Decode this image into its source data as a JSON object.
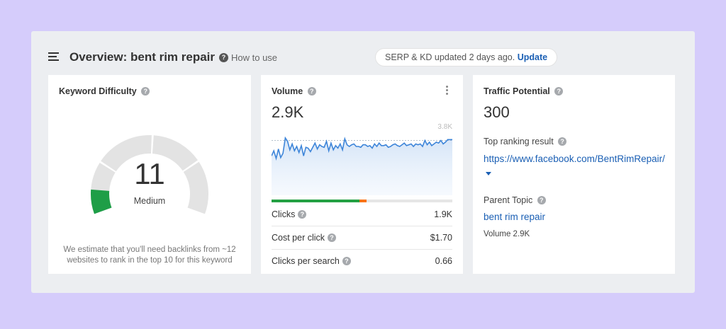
{
  "header": {
    "title": "Overview: bent rim repair",
    "how_to_use": "How to use",
    "serp_status": "SERP & KD updated 2 days ago.",
    "update_label": "Update"
  },
  "keyword_difficulty": {
    "title": "Keyword Difficulty",
    "value": "11",
    "level": "Medium",
    "note": "We estimate that you'll need backlinks from ~12 websites to rank in the top 10 for this keyword",
    "gauge_fraction": 0.11,
    "gauge_color": "#1e9e47"
  },
  "volume": {
    "title": "Volume",
    "value": "2.9K",
    "chart_max_label": "3.8K",
    "clicks_split": {
      "organic": 0.485,
      "paid": 0.04,
      "no_click": 0.475
    },
    "split_colors": {
      "organic": "#24a043",
      "paid": "#f97316",
      "no_click": "#e6e6e6"
    },
    "metrics": [
      {
        "label": "Clicks",
        "value": "1.9K"
      },
      {
        "label": "Cost per click",
        "value": "$1.70"
      },
      {
        "label": "Clicks per search",
        "value": "0.66"
      }
    ]
  },
  "traffic_potential": {
    "title": "Traffic Potential",
    "value": "300",
    "top_ranking_label": "Top ranking result",
    "top_ranking_url": "https://www.facebook.com/BentRimRepair/",
    "parent_topic_label": "Parent Topic",
    "parent_topic": "bent rim repair",
    "parent_volume": "Volume 2.9K"
  },
  "chart_data": {
    "type": "area",
    "title": "",
    "y_max_label": "3.8K",
    "ylim": [
      0,
      3800
    ],
    "values": [
      2300,
      2600,
      2150,
      2700,
      2200,
      2450,
      3350,
      3150,
      2650,
      3000,
      2600,
      2850,
      2500,
      2900,
      2300,
      2800,
      2750,
      2550,
      2800,
      3050,
      2700,
      2950,
      2850,
      2800,
      3150,
      2600,
      3050,
      2650,
      2900,
      2750,
      3000,
      2650,
      3300,
      2950,
      2850,
      2950,
      3000,
      2850,
      2850,
      2800,
      2950,
      2950,
      2850,
      2900,
      2750,
      3000,
      2850,
      3050,
      2900,
      2900,
      2950,
      2800,
      2850,
      2950,
      3000,
      2900,
      2850,
      2950,
      3050,
      2900,
      2950,
      3000,
      2850,
      3000,
      2950,
      3000,
      2850,
      3200,
      2950,
      3100,
      2900,
      3000,
      3100,
      3050,
      3200,
      3000,
      3100,
      3250,
      3250,
      3250
    ],
    "series_color": "#3d85d9",
    "grid": false
  }
}
